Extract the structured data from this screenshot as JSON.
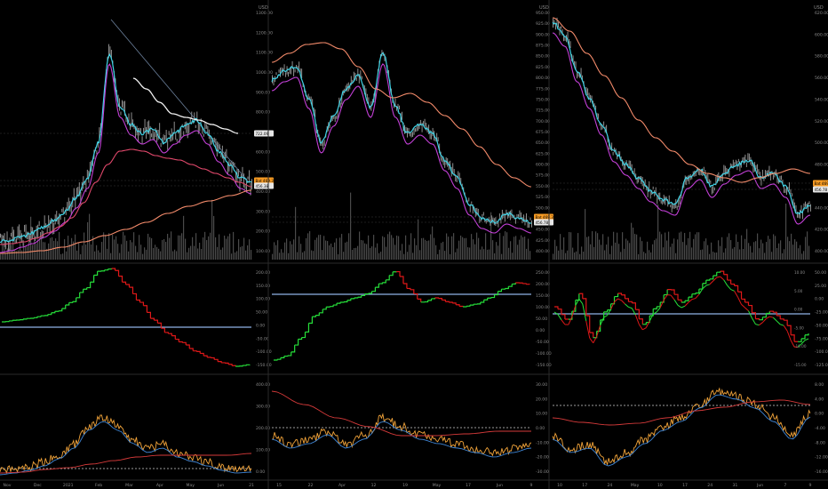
{
  "theme": {
    "background": "#000000",
    "grid": "#1c1c1c",
    "divider": "#2a2a2a",
    "axis_text": "#8a8a8a",
    "price": "#8f8f8f",
    "ema_fast": "#3fd3e6",
    "ema_mid": "#e0486b",
    "ema_slow": "#c23fd6",
    "ema_long": "#f28a6a",
    "sma_white": "#f2f2f2",
    "osc_green": "#26e03a",
    "osc_red": "#e01818",
    "zero_line": "#8fb4e6",
    "volume": "#4a4a4a",
    "rsi_line": "#f2a43a",
    "rsi_blue": "#3f86d6",
    "rsi_red": "#d63a3a",
    "tag_orange": "#f59a23",
    "tag_white": "#e6e6e6"
  },
  "panels": [
    {
      "id": "left",
      "currency": "USD",
      "price_axis": [
        "1300.00",
        "1200.00",
        "1100.00",
        "1000.00",
        "900.00",
        "800.00",
        "700.00",
        "600.00",
        "500.00",
        "400.00",
        "300.00",
        "200.00",
        "100.00"
      ],
      "price_tags": [
        {
          "label": "722.09",
          "style": "white"
        },
        {
          "label": "Bat 469.33",
          "style": "orange"
        },
        {
          "label": "456.38",
          "style": "white"
        }
      ],
      "osc_axis": [
        "200.00",
        "150.00",
        "100.00",
        "50.00",
        "0.00",
        "-50.00",
        "-100.00",
        "-150.00"
      ],
      "rsi_axis": [
        "400.00",
        "300.00",
        "200.00",
        "100.00",
        "0.00"
      ],
      "time_axis": [
        "Nov",
        "Dec",
        "2021",
        "Feb",
        "Mar",
        "Apr",
        "May",
        "Jun",
        "21"
      ]
    },
    {
      "id": "middle",
      "currency": "USD",
      "price_axis": [
        "950.00",
        "925.00",
        "900.00",
        "875.00",
        "850.00",
        "825.00",
        "800.00",
        "775.00",
        "750.00",
        "725.00",
        "700.00",
        "675.00",
        "650.00",
        "625.00",
        "600.00",
        "575.00",
        "550.00",
        "525.00",
        "500.00",
        "475.00",
        "450.00",
        "425.00",
        "400.00"
      ],
      "price_tags": [
        {
          "label": "Bat 469.33",
          "style": "orange"
        },
        {
          "label": "456.78",
          "style": "white"
        }
      ],
      "osc_axis": [
        "250.00",
        "200.00",
        "150.00",
        "100.00",
        "50.00",
        "0.00",
        "-50.00",
        "-100.00",
        "-150.00"
      ],
      "rsi_axis": [
        "30.00",
        "20.00",
        "10.00",
        "0.00",
        "-10.00",
        "-20.00",
        "-30.00"
      ],
      "time_axis": [
        "15",
        "22",
        "Apr",
        "12",
        "19",
        "May",
        "17",
        "Jun",
        "9"
      ]
    },
    {
      "id": "right",
      "currency": "USD",
      "price_axis": [
        "620.00",
        "600.00",
        "580.00",
        "560.00",
        "540.00",
        "520.00",
        "500.00",
        "480.00",
        "460.00",
        "440.00",
        "420.00",
        "400.00"
      ],
      "price_tags": [
        {
          "label": "Bat 469.33",
          "style": "orange"
        },
        {
          "label": "456.78",
          "style": "white"
        }
      ],
      "osc_axis": [
        "50.00",
        "25.00",
        "0.00",
        "-25.00",
        "-50.00",
        "-75.00",
        "-100.00",
        "-125.00"
      ],
      "osc_axis_right": [
        "10.00",
        "5.00",
        "0.00",
        "-5.00",
        "-10.00",
        "-15.00"
      ],
      "rsi_axis": [
        "8.00",
        "4.00",
        "0.00",
        "-4.00",
        "-8.00",
        "-12.00",
        "-16.00"
      ],
      "time_axis": [
        "10",
        "17",
        "24",
        "May",
        "10",
        "17",
        "24",
        "31",
        "Jun",
        "7",
        "9"
      ]
    }
  ]
}
